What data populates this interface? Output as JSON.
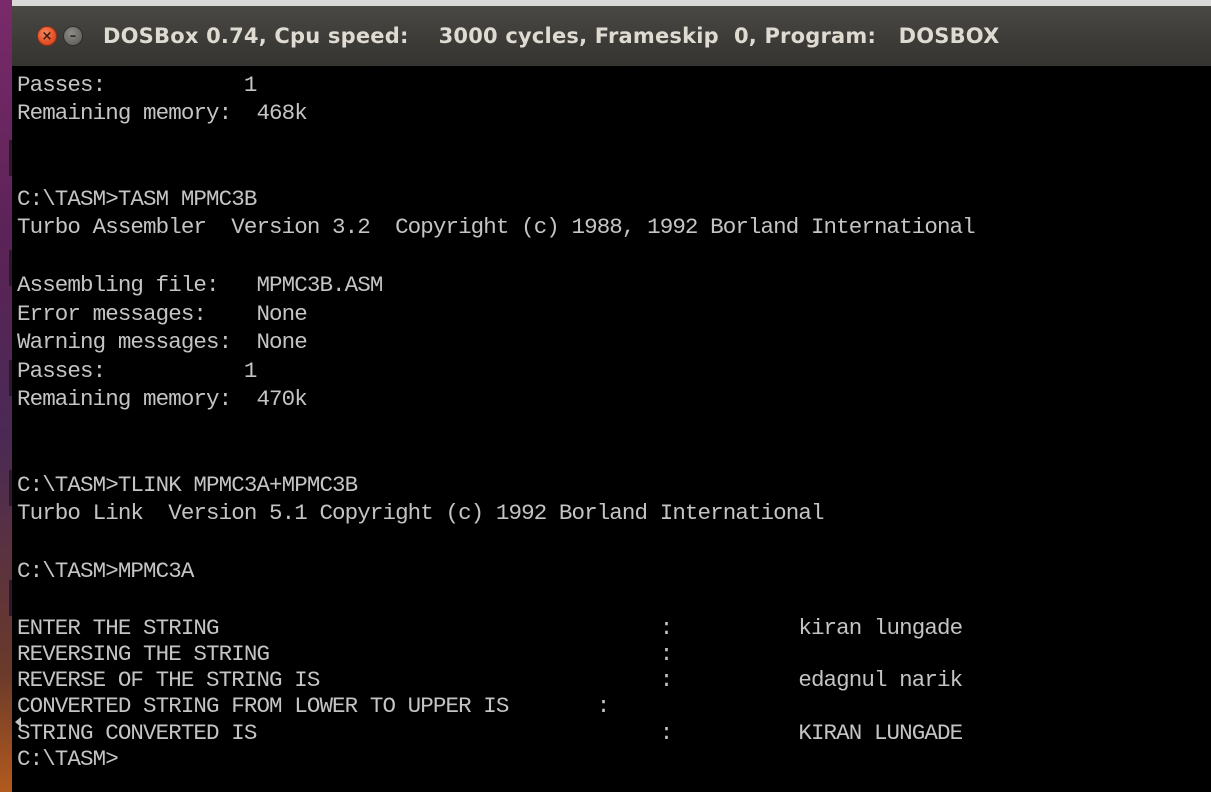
{
  "window": {
    "title": "DOSBox 0.74, Cpu speed:    3000 cycles, Frameskip  0, Program:   DOSBOX",
    "close_glyph": "×",
    "minimize_glyph": "–"
  },
  "terminal": {
    "lines": [
      "Passes:           1",
      "Remaining memory:  468k",
      "",
      "",
      "C:\\TASM>TASM MPMC3B",
      "Turbo Assembler  Version 3.2  Copyright (c) 1988, 1992 Borland International",
      "",
      "Assembling file:   MPMC3B.ASM",
      "Error messages:    None",
      "Warning messages:  None",
      "Passes:           1",
      "Remaining memory:  470k",
      "",
      "",
      "C:\\TASM>TLINK MPMC3A+MPMC3B",
      "Turbo Link  Version 5.1 Copyright (c) 1992 Borland International",
      "",
      "C:\\TASM>MPMC3A",
      "",
      "ENTER THE STRING                                   :          kiran lungade",
      "REVERSING THE STRING                               :",
      "REVERSE OF THE STRING IS                           :          edagnul narik",
      "CONVERTED STRING FROM LOWER TO UPPER IS       :",
      "STRING CONVERTED IS                                :          KIRAN LUNGADE",
      "C:\\TASM>"
    ]
  },
  "colors": {
    "terminal_bg": "#000000",
    "terminal_fg": "#c4c4c4",
    "titlebar_bg": "#3c3b37",
    "title_fg": "#dfdbd2",
    "close_button": "#e5532b",
    "minimize_button": "#6d6b66"
  }
}
